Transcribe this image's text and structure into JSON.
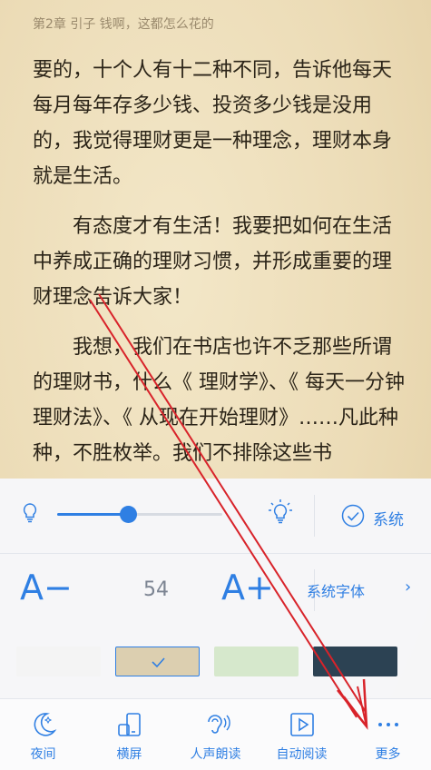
{
  "chapter_title": "第2章 引子 钱啊，这都怎么花的",
  "paragraphs": [
    "要的，十个人有十二种不同，告诉他每天每月每年存多少钱、投资多少钱是没用的，我觉得理财更是一种理念，理财本身就是生活。",
    "有态度才有生活！我要把如何在生活中养成正确的理财习惯，并形成重要的理财理念告诉大家！",
    "我想，我们在书店也许不乏那些所谓的理财书，什么《 理财学》、《 每天一分钟理财法》、《 从现在开始理财》……凡此种种，不胜枚举。我们不排除这些书"
  ],
  "settings": {
    "brightness": {
      "level": 0.43,
      "system_label": "系统"
    },
    "font": {
      "decrease_label": "A−",
      "size_value": "54",
      "increase_label": "A+",
      "font_face_label": "系统字体",
      "chevron": "›"
    },
    "themes": [
      {
        "name": "white",
        "color": "#f4f4f4",
        "selected": false
      },
      {
        "name": "parchment",
        "color": "#dccfb0",
        "selected": true
      },
      {
        "name": "green",
        "color": "#d6e8cc",
        "selected": false
      },
      {
        "name": "navy",
        "color": "#2c4253",
        "selected": false
      }
    ],
    "accent_color": "#2f7fe3"
  },
  "toolbar": {
    "night_label": "夜间",
    "landscape_label": "横屏",
    "tts_label": "人声朗读",
    "autoread_label": "自动阅读",
    "more_label": "更多"
  },
  "annotation": {
    "arrow_color": "#d8232a"
  }
}
